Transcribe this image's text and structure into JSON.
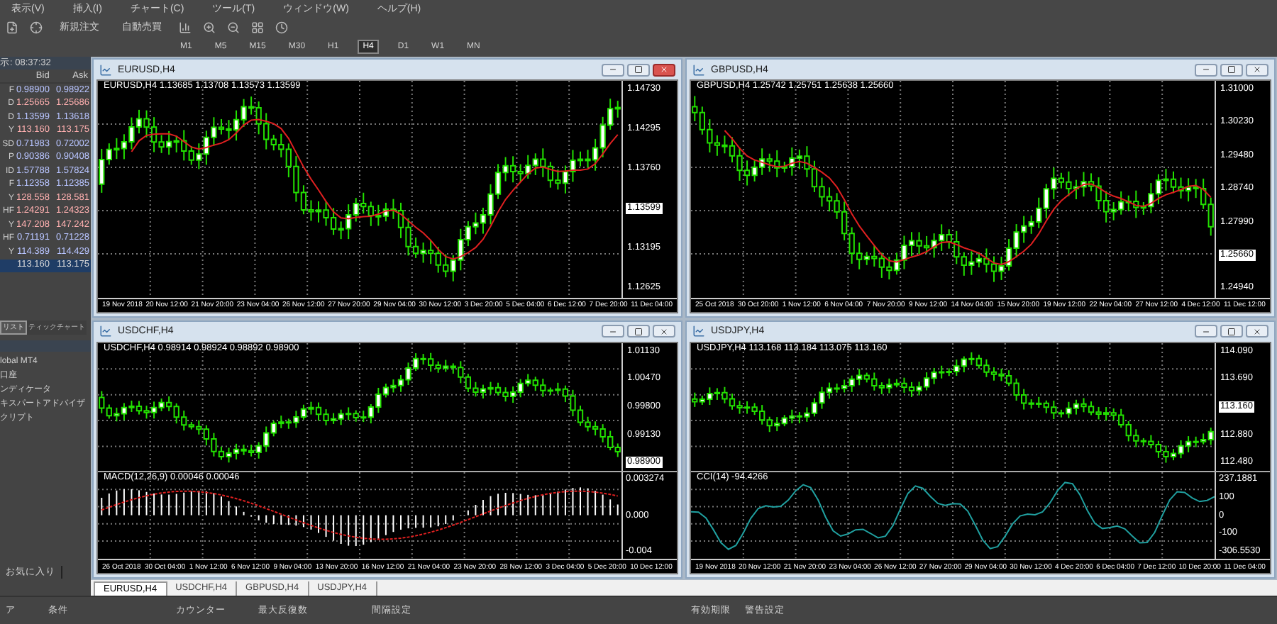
{
  "menu": [
    "表示(V)",
    "挿入(I)",
    "チャート(C)",
    "ツール(T)",
    "ウィンドウ(W)",
    "ヘルプ(H)"
  ],
  "toolbar": {
    "buttons": [
      "新規注文",
      "自動売買"
    ],
    "timeframes": [
      {
        "label": "M1",
        "selected": false
      },
      {
        "label": "M5",
        "selected": false
      },
      {
        "label": "M15",
        "selected": false
      },
      {
        "label": "M30",
        "selected": false
      },
      {
        "label": "H1",
        "selected": false
      },
      {
        "label": "H4",
        "selected": true
      },
      {
        "label": "D1",
        "selected": false
      },
      {
        "label": "W1",
        "selected": false
      },
      {
        "label": "MN",
        "selected": false
      }
    ]
  },
  "market_watch": {
    "header": "示: 08:37:32",
    "columns": [
      "Bid",
      "Ask"
    ],
    "rows": [
      {
        "symbol": "F",
        "bid": "0.98900",
        "ask": "0.98922",
        "color": "#b8c4ff",
        "selected": false
      },
      {
        "symbol": "D",
        "bid": "1.25665",
        "ask": "1.25686",
        "color": "#ffb0b0",
        "selected": false
      },
      {
        "symbol": "D",
        "bid": "1.13599",
        "ask": "1.13618",
        "color": "#b8c4ff",
        "selected": false
      },
      {
        "symbol": "Y",
        "bid": "113.160",
        "ask": "113.175",
        "color": "#ffb0b0",
        "selected": false
      },
      {
        "symbol": "SD",
        "bid": "0.71983",
        "ask": "0.72002",
        "color": "#b8c4ff",
        "selected": false
      },
      {
        "symbol": "P",
        "bid": "0.90386",
        "ask": "0.90408",
        "color": "#b8c4ff",
        "selected": false
      },
      {
        "symbol": "ID",
        "bid": "1.57788",
        "ask": "1.57824",
        "color": "#b8c4ff",
        "selected": false
      },
      {
        "symbol": "F",
        "bid": "1.12358",
        "ask": "1.12385",
        "color": "#b8c4ff",
        "selected": false
      },
      {
        "symbol": "Y",
        "bid": "128.558",
        "ask": "128.581",
        "color": "#ffb0b0",
        "selected": false
      },
      {
        "symbol": "HF",
        "bid": "1.24291",
        "ask": "1.24323",
        "color": "#ffb0b0",
        "selected": false
      },
      {
        "symbol": "Y",
        "bid": "147.208",
        "ask": "147.242",
        "color": "#ffb0b0",
        "selected": false
      },
      {
        "symbol": "HF",
        "bid": "0.71191",
        "ask": "0.71228",
        "color": "#b8c4ff",
        "selected": false
      },
      {
        "symbol": "Y",
        "bid": "114.389",
        "ask": "114.429",
        "color": "#b8c4ff",
        "selected": false
      },
      {
        "symbol": "",
        "bid": "113.160",
        "ask": "113.175",
        "selected": true
      }
    ],
    "tabs": [
      {
        "label": "リスト",
        "selected": true
      },
      {
        "label": "ティックチャート",
        "selected": false
      }
    ]
  },
  "navigator": {
    "items": [
      "lobal MT4",
      "口座",
      "ンディケータ",
      "キスパートアドバイザ",
      "クリプト"
    ],
    "tab": "お気に入り"
  },
  "charts": [
    {
      "title": "EURUSD,H4",
      "active": true,
      "info": "EURUSD,H4  1.13685 1.13708 1.13573 1.13599",
      "ma_line": true,
      "prices": [
        {
          "label": "1.14730",
          "current": false
        },
        {
          "label": "1.14295",
          "current": false
        },
        {
          "label": "1.13760",
          "current": false
        },
        {
          "label": "1.13599",
          "current": true
        },
        {
          "label": "1.13195",
          "current": false
        },
        {
          "label": "1.12625",
          "current": false
        }
      ],
      "times": [
        "19 Nov 2018",
        "20 Nov 12:00",
        "21 Nov 20:00",
        "23 Nov 04:00",
        "26 Nov 12:00",
        "27 Nov 20:00",
        "29 Nov 04:00",
        "30 Nov 12:00",
        "3 Dec 20:00",
        "5 Dec 04:00",
        "6 Dec 12:00",
        "7 Dec 20:00",
        "11 Dec 04:00"
      ]
    },
    {
      "title": "GBPUSD,H4",
      "active": false,
      "info": "GBPUSD,H4  1.25742 1.25751 1.25638 1.25660",
      "ma_line": true,
      "prices": [
        {
          "label": "1.31000",
          "current": false
        },
        {
          "label": "1.30230",
          "current": false
        },
        {
          "label": "1.29480",
          "current": false
        },
        {
          "label": "1.28740",
          "current": false
        },
        {
          "label": "1.27990",
          "current": false
        },
        {
          "label": "1.25660",
          "current": true
        },
        {
          "label": "1.24940",
          "current": false
        }
      ],
      "times": [
        "25 Oct 2018",
        "30 Oct 20:00",
        "1 Nov 12:00",
        "6 Nov 04:00",
        "7 Nov 20:00",
        "9 Nov 12:00",
        "14 Nov 04:00",
        "15 Nov 20:00",
        "19 Nov 12:00",
        "22 Nov 04:00",
        "27 Nov 12:00",
        "4 Dec 12:00",
        "11 Dec 12:00"
      ]
    },
    {
      "title": "USDCHF,H4",
      "active": false,
      "info": "USDCHF,H4  0.98914 0.98924 0.98892 0.98900",
      "ma_line": false,
      "prices": [
        {
          "label": "1.01130",
          "current": false
        },
        {
          "label": "1.00470",
          "current": false
        },
        {
          "label": "0.99800",
          "current": false
        },
        {
          "label": "0.99130",
          "current": false
        },
        {
          "label": "0.98900",
          "current": true
        }
      ],
      "indicator": {
        "kind": "macd",
        "label": "MACD(12,26,9) 0.00046 0.00046",
        "scale": [
          "0.003274",
          "0.000",
          "-0.004"
        ]
      },
      "times": [
        "26 Oct 2018",
        "30 Oct 04:00",
        "1 Nov 12:00",
        "6 Nov 12:00",
        "9 Nov 04:00",
        "13 Nov 20:00",
        "16 Nov 12:00",
        "21 Nov 04:00",
        "23 Nov 20:00",
        "28 Nov 12:00",
        "3 Dec 04:00",
        "5 Dec 20:00",
        "10 Dec 12:00"
      ]
    },
    {
      "title": "USDJPY,H4",
      "active": false,
      "info": "USDJPY,H4  113.168 113.184 113.075 113.160",
      "ma_line": false,
      "prices": [
        {
          "label": "114.090",
          "current": false
        },
        {
          "label": "113.690",
          "current": false
        },
        {
          "label": "113.160",
          "current": true
        },
        {
          "label": "112.880",
          "current": false
        },
        {
          "label": "112.480",
          "current": false
        }
      ],
      "indicator": {
        "kind": "cci",
        "label": "CCI(14) -94.4266",
        "scale": [
          "237.1881",
          "100",
          "0",
          "-100",
          "-306.5530"
        ]
      },
      "times": [
        "19 Nov 2018",
        "20 Nov 12:00",
        "21 Nov 20:00",
        "23 Nov 04:00",
        "26 Nov 12:00",
        "27 Nov 20:00",
        "29 Nov 04:00",
        "30 Nov 12:00",
        "4 Dec 20:00",
        "6 Dec 04:00",
        "7 Dec 12:00",
        "10 Dec 20:00",
        "11 Dec 04:00"
      ]
    }
  ],
  "chart_tabs": [
    {
      "label": "EURUSD,H4",
      "selected": true
    },
    {
      "label": "USDCHF,H4",
      "selected": false
    },
    {
      "label": "GBPUSD,H4",
      "selected": false
    },
    {
      "label": "USDJPY,H4",
      "selected": false
    }
  ],
  "terminal_columns": [
    "ア",
    "条件",
    "カウンター",
    "最大反復数",
    "間隔設定",
    "有効期限",
    "警告設定"
  ]
}
